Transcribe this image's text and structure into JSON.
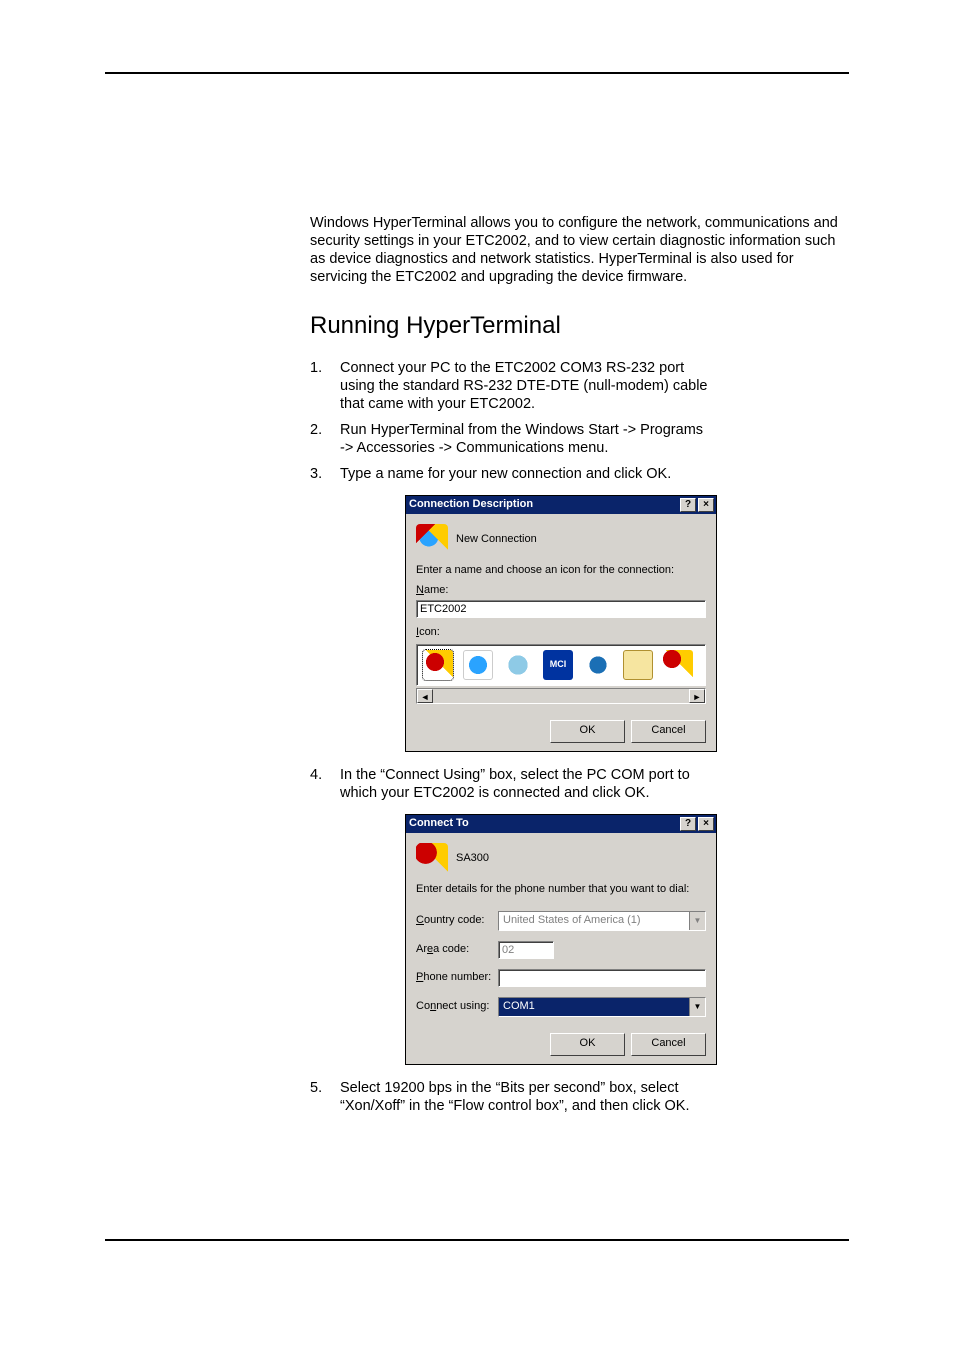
{
  "intro": "Windows HyperTerminal allows you to configure the network, communications and security settings in your ETC2002, and to view certain diagnostic information such as device diagnostics and network statistics. HyperTerminal is also used for servicing the ETC2002 and upgrading the device firmware.",
  "heading": "Running HyperTerminal",
  "steps": [
    "Connect your PC to the ETC2002 COM3 RS-232 port using the standard RS-232 DTE-DTE (null-modem) cable that came with your ETC2002.",
    "Run HyperTerminal from the Windows Start -> Programs -> Accessories -> Communications menu.",
    "Type a name for your new connection and click OK.",
    "In the “Connect Using” box, select the PC COM port to which your ETC2002 is connected and click OK.",
    "Select 19200 bps in the “Bits per second” box, select “Xon/Xoff” in the “Flow control box”, and then click OK."
  ],
  "dialog1": {
    "title": "Connection Description",
    "icon_label": "New Connection",
    "prompt": "Enter a name and choose an icon for the connection:",
    "name_label_pre": "N",
    "name_label": "ame:",
    "name_value": "ETC2002",
    "icon_label_pre": "I",
    "icon_label2": "con:",
    "ok": "OK",
    "cancel": "Cancel"
  },
  "dialog2": {
    "title": "Connect To",
    "icon_label": "SA300",
    "prompt": "Enter details for the phone number that you want to dial:",
    "country_pre": "C",
    "country_label": "ountry code:",
    "country_value": "United States of America (1)",
    "area_label_a": "Ar",
    "area_label_u": "e",
    "area_label_b": "a code:",
    "area_value": "02",
    "phone_pre": "P",
    "phone_label": "hone number:",
    "phone_value": "",
    "connect_label_a": "Co",
    "connect_label_u": "n",
    "connect_label_b": "nect using:",
    "connect_value": "COM1",
    "ok": "OK",
    "cancel": "Cancel"
  }
}
